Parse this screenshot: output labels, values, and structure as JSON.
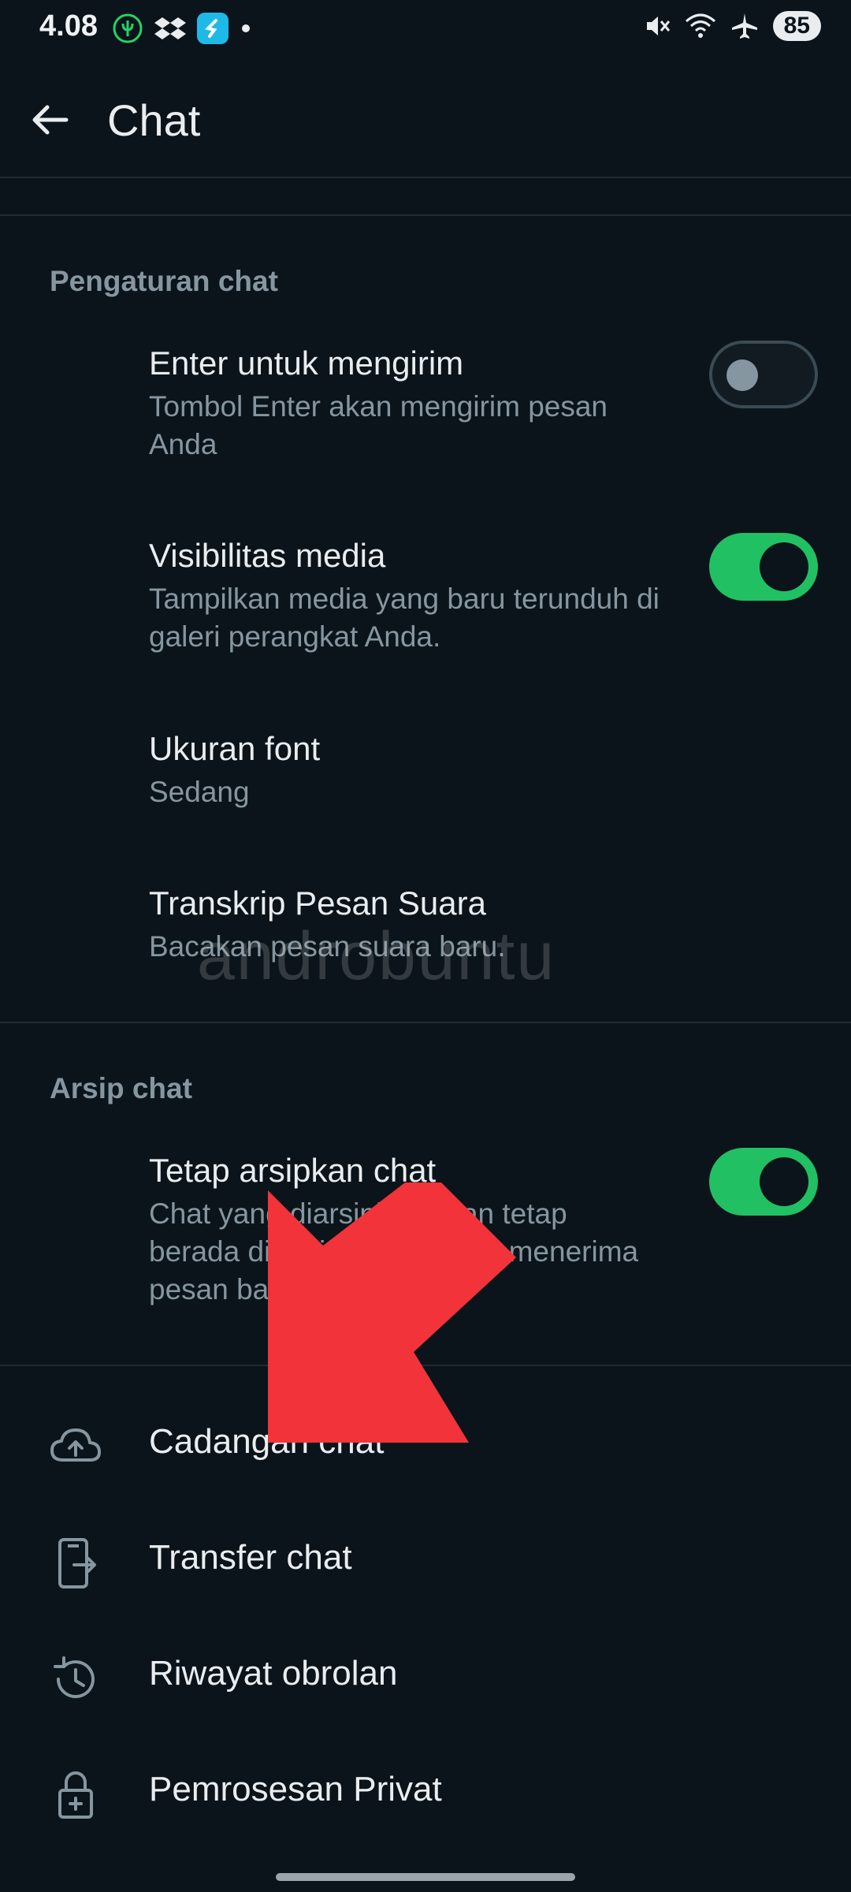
{
  "status_bar": {
    "time": "4.08",
    "battery": "85",
    "left_icons": [
      "leaf-icon",
      "dropbox-icon",
      "shazam-icon",
      "dot-icon"
    ],
    "right_icons": [
      "mute-icon",
      "wifi-icon",
      "airplane-icon"
    ]
  },
  "app_bar": {
    "title": "Chat"
  },
  "sections": {
    "chat_settings_header": "Pengaturan chat",
    "enter_send": {
      "title": "Enter untuk mengirim",
      "subtitle": "Tombol Enter akan mengirim pesan Anda",
      "toggle": "off"
    },
    "media_visibility": {
      "title": "Visibilitas media",
      "subtitle": "Tampilkan media yang baru terunduh di galeri perangkat Anda.",
      "toggle": "on"
    },
    "font_size": {
      "title": "Ukuran font",
      "subtitle": "Sedang"
    },
    "voice_transcript": {
      "title": "Transkrip Pesan Suara",
      "subtitle": "Bacakan pesan suara baru."
    },
    "archive_header": "Arsip chat",
    "keep_archived": {
      "title": "Tetap arsipkan chat",
      "subtitle": "Chat yang diarsipkan akan tetap berada di arsip meski Anda menerima pesan baru",
      "toggle": "on"
    }
  },
  "menu": {
    "backup": "Cadangan chat",
    "transfer": "Transfer chat",
    "history": "Riwayat obrolan",
    "private_processing": "Pemrosesan Privat"
  },
  "watermark": "androbuntu",
  "colors": {
    "background": "#0b141a",
    "accent_green": "#21c063",
    "secondary_text": "#8696a0",
    "annotation_arrow": "#f2333a"
  }
}
